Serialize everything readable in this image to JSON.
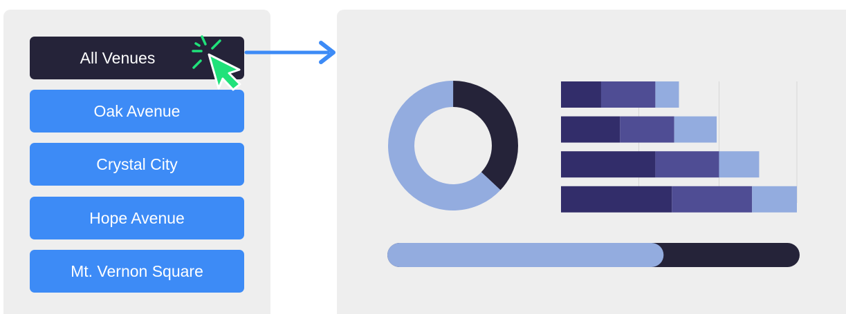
{
  "venue_list": {
    "items": [
      {
        "label": "All Venues",
        "active": true
      },
      {
        "label": "Oak Avenue",
        "active": false
      },
      {
        "label": "Crystal City",
        "active": false
      },
      {
        "label": "Hope Avenue",
        "active": false
      },
      {
        "label": "Mt. Vernon Square",
        "active": false
      }
    ]
  },
  "colors": {
    "button": "#3d8bf6",
    "button_active": "#252339",
    "dark": "#252339",
    "navy": "#322d6a",
    "purple": "#4f4d94",
    "light": "#93acdf",
    "cursor": "#20e27a",
    "arrow": "#3d8bf6",
    "panel": "#eeeeee"
  },
  "icons": {
    "cursor": "pointer-cursor-icon",
    "click": "click-burst-icon",
    "arrow": "arrow-right-icon"
  },
  "dashboard": {
    "donut": {
      "segments": [
        {
          "color": "dark",
          "fraction": 0.37
        },
        {
          "color": "light",
          "fraction": 0.63
        }
      ]
    },
    "bars": [
      [
        0.17,
        0.23,
        0.1
      ],
      [
        0.25,
        0.23,
        0.18
      ],
      [
        0.4,
        0.27,
        0.17
      ],
      [
        0.47,
        0.34,
        0.19
      ]
    ],
    "progress": 0.67
  }
}
